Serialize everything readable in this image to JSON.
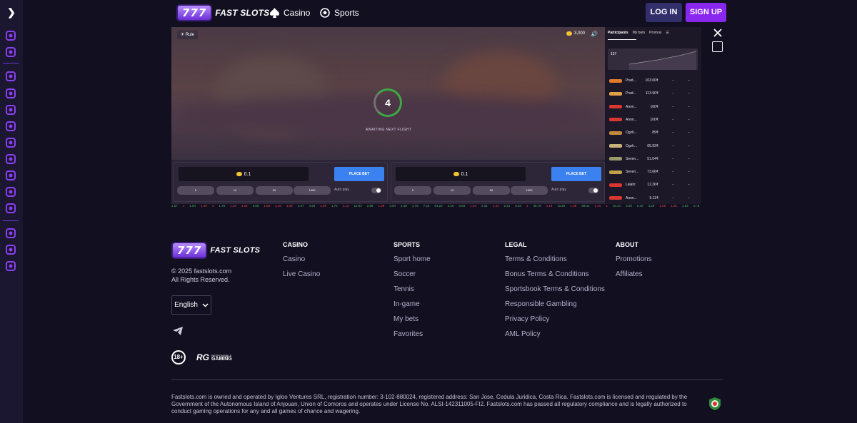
{
  "header": {
    "logo_digits": "777",
    "logo_word": "FAST SLOTS",
    "nav": [
      {
        "label": "Casino",
        "icon": "spade-icon"
      },
      {
        "label": "Sports",
        "icon": "soccer-ball-icon"
      }
    ],
    "login_label": "LOG IN",
    "signup_label": "SIGN UP"
  },
  "sidebar": {
    "expand_icon": "chevron-right-icon",
    "icons": [
      "gift-box-icon",
      "slot-tile-icon",
      "star-badge-icon",
      "live-broadcast-icon",
      "target-icon",
      "tennis-icon",
      "basketball-icon",
      "hockey-stick-icon",
      "american-football-icon",
      "racing-car-icon",
      "store-icon",
      "fire-icon",
      "megaphone-icon",
      "whistle-icon"
    ],
    "accent": "#8a3ff0"
  },
  "game": {
    "rules_label": "Rule",
    "balance": "3,000",
    "countdown": "4",
    "status": "AWAITING NEXT FLIGHT",
    "bet_panels": [
      {
        "amount": "0.1",
        "place_label": "PLACE BET",
        "quick": [
          "5",
          "10",
          "50",
          "1000"
        ],
        "auto_label": "Auto play"
      },
      {
        "amount": "0.1",
        "place_label": "PLACE BET",
        "quick": [
          "5",
          "10",
          "50",
          "1000"
        ],
        "auto_label": "Auto play"
      }
    ],
    "side_tabs": [
      "Participants",
      "My bets",
      "Promos"
    ],
    "participant_count": "157",
    "participants": [
      {
        "name": "Prad...",
        "amount": "103.00₹",
        "color": "#e07a2c"
      },
      {
        "name": "Prad...",
        "amount": "113.90₹",
        "color": "#e0a04a"
      },
      {
        "name": "Anon...",
        "amount": "100₹",
        "color": "#d8372f"
      },
      {
        "name": "Anon...",
        "amount": "100₹",
        "color": "#d8372f"
      },
      {
        "name": "Ogzh...",
        "amount": "89₹",
        "color": "#c48a3b"
      },
      {
        "name": "Ogzh...",
        "amount": "65.93₹",
        "color": "#c9b27a"
      },
      {
        "name": "Seven...",
        "amount": "51.04₹",
        "color": "#9a9a6a"
      },
      {
        "name": "Seven...",
        "amount": "73.66₹",
        "color": "#c0a24a"
      },
      {
        "name": "Lalahr",
        "amount": "12.26₹",
        "color": "#d8372f"
      },
      {
        "name": "Anon...",
        "amount": "5.11₹",
        "color": "#d8372f"
      }
    ],
    "ticker": [
      {
        "v": "1.57",
        "c": "#4fae5a"
      },
      {
        "v": "1",
        "c": "#e0443f"
      },
      {
        "v": "1.64",
        "c": "#4fae5a"
      },
      {
        "v": "1.40",
        "c": "#e0443f"
      },
      {
        "v": "1",
        "c": "#e0443f"
      },
      {
        "v": "1.78",
        "c": "#4fae5a"
      },
      {
        "v": "1.33",
        "c": "#e0443f"
      },
      {
        "v": "1.34",
        "c": "#e0443f"
      },
      {
        "v": "3.86",
        "c": "#4fae5a"
      },
      {
        "v": "1.53",
        "c": "#e0443f"
      },
      {
        "v": "1.16",
        "c": "#e0443f"
      },
      {
        "v": "1.09",
        "c": "#e0443f"
      },
      {
        "v": "1.07",
        "c": "#4fae5a"
      },
      {
        "v": "4.55",
        "c": "#4fae5a"
      },
      {
        "v": "1.09",
        "c": "#e0443f"
      },
      {
        "v": "1.72",
        "c": "#4fae5a"
      },
      {
        "v": "1.13",
        "c": "#e0443f"
      },
      {
        "v": "12.94",
        "c": "#4fae5a"
      },
      {
        "v": "2.88",
        "c": "#4fae5a"
      },
      {
        "v": "1.39",
        "c": "#e0443f"
      },
      {
        "v": "3.84",
        "c": "#4fae5a"
      },
      {
        "v": "2.48",
        "c": "#4fae5a"
      },
      {
        "v": "1.78",
        "c": "#4fae5a"
      },
      {
        "v": "7.23",
        "c": "#4fae5a"
      },
      {
        "v": "64.22",
        "c": "#4fae5a"
      },
      {
        "v": "2.16",
        "c": "#4fae5a"
      },
      {
        "v": "3.93",
        "c": "#4fae5a"
      },
      {
        "v": "1.04",
        "c": "#e0443f"
      },
      {
        "v": "2.31",
        "c": "#4fae5a"
      },
      {
        "v": "1.41",
        "c": "#e0443f"
      },
      {
        "v": "2.21",
        "c": "#4fae5a"
      },
      {
        "v": "6.34",
        "c": "#4fae5a"
      },
      {
        "v": "1",
        "c": "#e0443f"
      },
      {
        "v": "48.78",
        "c": "#4fae5a"
      },
      {
        "v": "1.14",
        "c": "#e0443f"
      },
      {
        "v": "11.82",
        "c": "#4fae5a"
      },
      {
        "v": "1.38",
        "c": "#e0443f"
      },
      {
        "v": "39.41",
        "c": "#4fae5a"
      },
      {
        "v": "1.41",
        "c": "#e0443f"
      },
      {
        "v": "1",
        "c": "#e0443f"
      },
      {
        "v": "15.44",
        "c": "#4fae5a"
      },
      {
        "v": "3.09",
        "c": "#4fae5a"
      },
      {
        "v": "5.19",
        "c": "#4fae5a"
      },
      {
        "v": "4.29",
        "c": "#4fae5a"
      },
      {
        "v": "1.06",
        "c": "#e0443f"
      },
      {
        "v": "1.26",
        "c": "#e0443f"
      },
      {
        "v": "1.53",
        "c": "#4fae5a"
      },
      {
        "v": "17.5",
        "c": "#4fae5a"
      },
      {
        "v": "1.83",
        "c": "#4fae5a"
      },
      {
        "v": "1.44",
        "c": "#e0443f"
      }
    ]
  },
  "footer": {
    "copyright_line1": "© 2025 fastslots.com",
    "copyright_line2": "All Rights Reserved.",
    "language": "English",
    "badge_18": "18+",
    "rg_mark": "RG",
    "rg_line1": "RESPONSIBLE",
    "rg_line2": "GAMING",
    "columns": [
      {
        "title": "CASINO",
        "links": [
          "Casino",
          "Live Casino"
        ]
      },
      {
        "title": "SPORTS",
        "links": [
          "Sport home",
          "Soccer",
          "Tennis",
          "In-game",
          "My bets",
          "Favorites"
        ]
      },
      {
        "title": "LEGAL",
        "links": [
          "Terms & Conditions",
          "Bonus Terms & Conditions",
          "Sportsbook Terms & Conditions",
          "Responsible Gambling",
          "Privacy Policy",
          "AML Policy"
        ]
      },
      {
        "title": "ABOUT",
        "links": [
          "Promotions",
          "Affiliates"
        ]
      }
    ],
    "legal_text": "Fastslots.com is owned and operated by Igloo Ventures SRL, registration number: 3-102-880024, registered address: San Jose, Cedula Juridica, Costa Rica. Fastslots.com is licensed and regulated by the Government of the Autonomous Island of Anjouan, Union of Comoros and operates under License No. ALSI-142311005-FI2. Fastslots.com has passed all regulatory compliance and is legally authorized to conduct gaming operations for any and all games of chance and wagering."
  }
}
